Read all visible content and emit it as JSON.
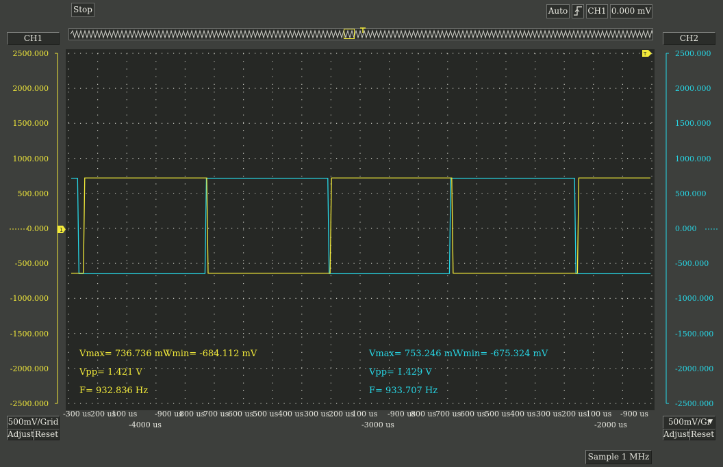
{
  "toolbar": {
    "stop_label": "Stop",
    "mode_label": "Auto",
    "trigger_source": "CH1",
    "trigger_level": "0.000 mV"
  },
  "ch1": {
    "header": "CH1",
    "scale": "500mV/Grid",
    "adjust_label": "Adjust",
    "reset_label": "Reset",
    "color": "#f2ea3a",
    "axis": [
      "2500.000",
      "2000.000",
      "1500.000",
      "1000.000",
      "500.000",
      "0.000",
      "-500.000",
      "-1000.000",
      "-1500.000",
      "-2000.000",
      "-2500.000"
    ],
    "measure": {
      "vmax": "Vmax= 736.736 mV",
      "vmin": "Vmin= -684.112 mV",
      "vpp": "Vpp= 1.421  V",
      "freq": "F= 932.836  Hz"
    }
  },
  "ch2": {
    "header": "CH2",
    "scale": "500mV/Gr",
    "adjust_label": "Adjust",
    "reset_label": "Reset",
    "color": "#27d7e6",
    "axis": [
      "2500.000",
      "2000.000",
      "1500.000",
      "1000.000",
      "500.000",
      "0.000",
      "-500.000",
      "-1000.000",
      "-1500.000",
      "-2000.000",
      "-2500.000"
    ],
    "measure": {
      "vmax": "Vmax= 753.246 mV",
      "vmin": "Vmin= -675.324 mV",
      "vpp": "Vpp= 1.429  V",
      "freq": "F= 933.707  Hz"
    }
  },
  "time_axis": {
    "top_row": [
      "-300 us",
      "200 us",
      "100 us",
      "-900 us",
      "800 us",
      "700 us",
      "600 us",
      "500 us",
      "400 us",
      "300 us",
      "200 us",
      "100 us",
      "-900 us",
      "800 us",
      "700 us",
      "600 us",
      "500 us",
      "400 us",
      "300 us",
      "200 us",
      "100 us",
      "-900 us"
    ],
    "bottom_row": [
      "-4000 us",
      "-3000 us",
      "-2000 us"
    ]
  },
  "status": {
    "sample": "Sample 1 MHz"
  },
  "waveform": {
    "ch1_high_mv": 720,
    "ch1_low_mv": -640,
    "ch2_high_mv": 715,
    "ch2_low_mv": -645,
    "ch1_edge_fractions": [
      0.021,
      0.234,
      0.447,
      0.657,
      0.874
    ],
    "ch1_first_state": "low",
    "ch2_edge_fractions": [
      0.011,
      0.231,
      0.443,
      0.653,
      0.869
    ],
    "ch2_first_state": "high"
  }
}
